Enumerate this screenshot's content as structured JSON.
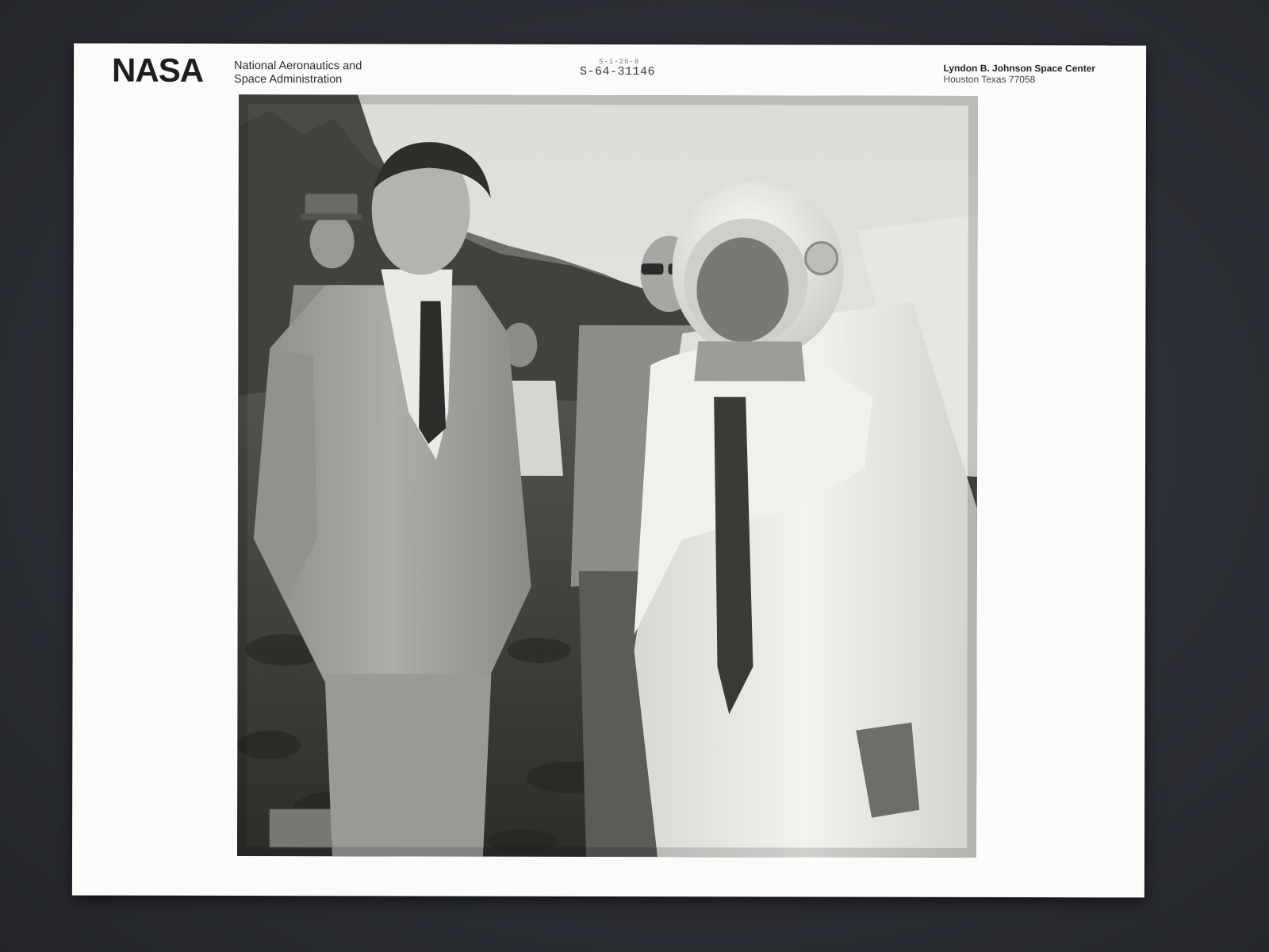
{
  "header": {
    "logo_text": "NASA",
    "agency_line1": "National Aeronautics and",
    "agency_line2": "Space Administration",
    "photo_number": "S-64-31146",
    "photo_number_overprint": "S-1-26-8",
    "center_line1": "Lyndon B. Johnson Space Center",
    "center_line2": "Houston Texas 77058"
  },
  "photo": {
    "subject": "black-and-white field photograph",
    "colors": {
      "sky": "#e4e4e0",
      "forest": "#4a4a47",
      "ground": "#3c3a37",
      "suit": "#eeeeea",
      "jacket": "#a7a59f"
    }
  }
}
